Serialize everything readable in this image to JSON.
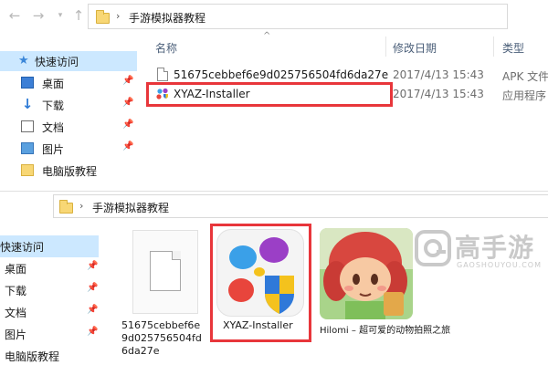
{
  "top_window": {
    "breadcrumb": {
      "separator": "›",
      "folder": "手游模拟器教程"
    },
    "nav": {
      "quick_access": "快速访问",
      "items": [
        {
          "label": "桌面",
          "icon": "desktop-icon",
          "pinned": true
        },
        {
          "label": "下载",
          "icon": "download-icon",
          "pinned": true
        },
        {
          "label": "文档",
          "icon": "document-icon",
          "pinned": true
        },
        {
          "label": "图片",
          "icon": "picture-icon",
          "pinned": true
        },
        {
          "label": "电脑版教程",
          "icon": "folder-icon",
          "pinned": false
        }
      ]
    },
    "columns": {
      "name": "名称",
      "date": "修改日期",
      "type": "类型"
    },
    "files": [
      {
        "name": "51675cebbef6e9d025756504fd6da27e",
        "date": "2017/4/13 15:43",
        "type": "APK 文件"
      },
      {
        "name": "XYAZ-Installer",
        "date": "2017/4/13 15:43",
        "type": "应用程序"
      }
    ]
  },
  "bottom_window": {
    "breadcrumb": {
      "separator": "›",
      "folder": "手游模拟器教程"
    },
    "nav": {
      "items": [
        {
          "label": "快速访问",
          "pinned": false
        },
        {
          "label": "桌面",
          "pinned": true
        },
        {
          "label": "下载",
          "pinned": true
        },
        {
          "label": "文档",
          "pinned": true
        },
        {
          "label": "图片",
          "pinned": true
        },
        {
          "label": "电脑版教程",
          "pinned": false
        }
      ]
    },
    "tiles": [
      {
        "label_lines": [
          "51675cebbef6e",
          "9d025756504fd",
          "6da27e"
        ]
      },
      {
        "label": "XYAZ-Installer"
      },
      {
        "label": "Hilomi – 超可爱的动物拍照之旅"
      }
    ]
  },
  "watermark": {
    "text": "高手游",
    "sub": "GAOSHOUYOU.COM"
  },
  "colors": {
    "highlight": "#e8363b",
    "selection": "#cce8ff",
    "folder": "#f8d775"
  }
}
